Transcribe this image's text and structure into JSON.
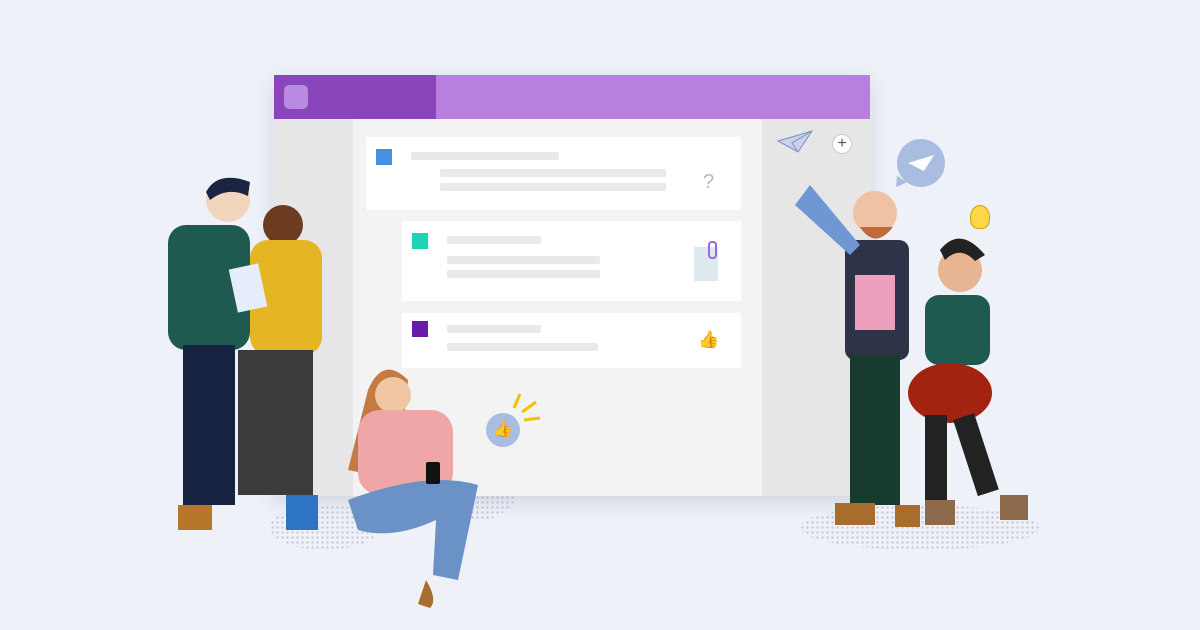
{
  "window": {
    "title_bar_left_color": "#8a45bd",
    "title_bar_right_color": "#b97fe0"
  },
  "cards": [
    {
      "accent": "#4a90e2",
      "icon": "question-mark-icon",
      "glyph": "?"
    },
    {
      "accent": "#1dd3b4",
      "icon": "sticky-note-icon"
    },
    {
      "accent": "#6a1ba8",
      "icon": "thumbs-up-icon",
      "glyph": "👍"
    }
  ],
  "right_pane": {
    "add_icon": "plus-icon",
    "add_glyph": "+"
  }
}
